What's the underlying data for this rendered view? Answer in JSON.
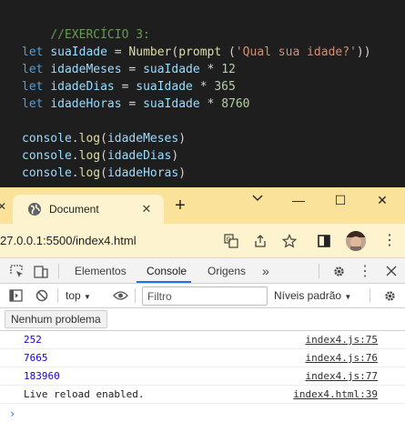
{
  "editor": {
    "comment": "//EXERCÍCIO 3:",
    "line1": {
      "kw": "let",
      "var": "suaIdade",
      "eq": " = ",
      "fn": "Number",
      "p1": "(",
      "fn2": "prompt",
      "p2": " (",
      "str": "'Qual sua idade?'",
      "p3": "))"
    },
    "line2": {
      "kw": "let",
      "var": "idadeMeses",
      "eq": " = ",
      "ref": "suaIdade",
      "op": " * ",
      "num": "12"
    },
    "line3": {
      "kw": "let",
      "var": "idadeDias",
      "eq": " = ",
      "ref": "suaIdade",
      "op": " * ",
      "num": "365"
    },
    "line4": {
      "kw": "let",
      "var": "idadeHoras",
      "eq": " = ",
      "ref": "suaIdade",
      "op": " * ",
      "num": "8760"
    },
    "log1": {
      "obj": "console",
      "dot": ".",
      "fn": "log",
      "open": "(",
      "arg": "idadeMeses",
      "close": ")"
    },
    "log2": {
      "obj": "console",
      "dot": ".",
      "fn": "log",
      "open": "(",
      "arg": "idadeDias",
      "close": ")"
    },
    "log3": {
      "obj": "console",
      "dot": ".",
      "fn": "log",
      "open": "(",
      "arg": "idadeHoras",
      "close": ")"
    }
  },
  "browser": {
    "tab_title": "Document",
    "tab_close": "✕",
    "new_tab": "+",
    "left_edge_glyph": "✕",
    "win_minimize": "—",
    "win_restore": "☐",
    "win_close": "✕",
    "url": "27.0.0.1:5500/index4.html"
  },
  "devtools": {
    "tabs": [
      "Elementos",
      "Console",
      "Origens"
    ],
    "more_tabs": "»",
    "context": "top",
    "filter_placeholder": "Filtro",
    "levels": "Níveis padrão",
    "issues": "Nenhum problema",
    "console_rows": [
      {
        "message": "252",
        "source": "index4.js:75",
        "numeric": true
      },
      {
        "message": "7665",
        "source": "index4.js:76",
        "numeric": true
      },
      {
        "message": "183960",
        "source": "index4.js:77",
        "numeric": true
      },
      {
        "message": "Live reload enabled.",
        "source": "index4.html:39",
        "numeric": false
      }
    ],
    "prompt": "›"
  },
  "colors": {
    "editor_bg": "#1e1e1e",
    "tabstrip_bg": "#fbe29a",
    "addrbar_bg": "#fdf3cf",
    "accent": "#1a73e8",
    "console_number": "#1c00cf"
  }
}
